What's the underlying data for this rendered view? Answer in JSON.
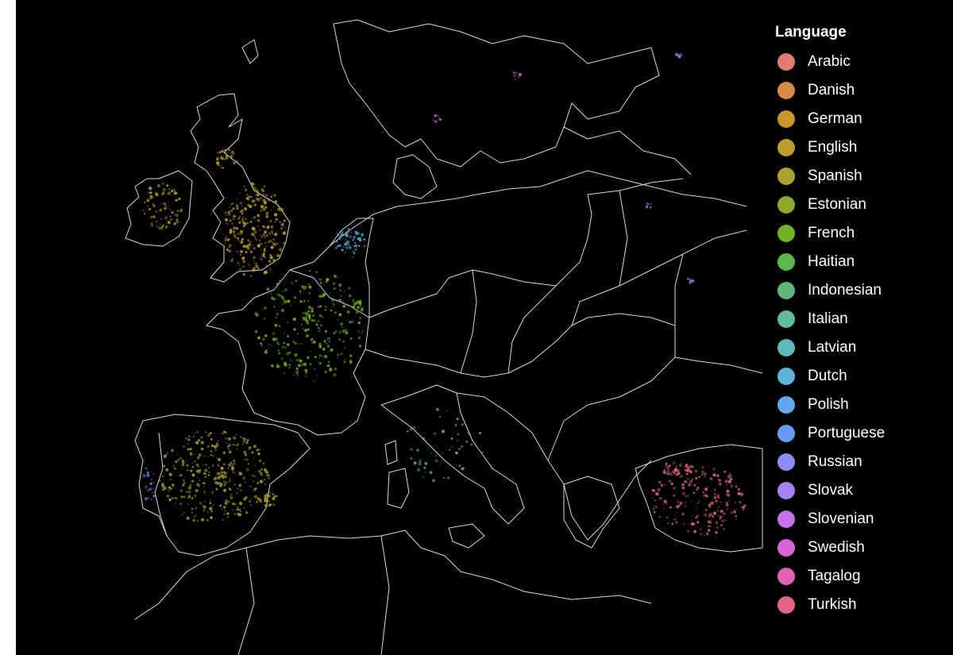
{
  "legend": {
    "title": "Language",
    "items": [
      {
        "label": "Arabic",
        "color": "#E07B70"
      },
      {
        "label": "Danish",
        "color": "#D98B45"
      },
      {
        "label": "German",
        "color": "#C9962B"
      },
      {
        "label": "English",
        "color": "#BC9E2C"
      },
      {
        "label": "Spanish",
        "color": "#A7A32D"
      },
      {
        "label": "Estonian",
        "color": "#8DAA2A"
      },
      {
        "label": "French",
        "color": "#70B324"
      },
      {
        "label": "Haitian",
        "color": "#5CB84B"
      },
      {
        "label": "Indonesian",
        "color": "#5DB87A"
      },
      {
        "label": "Italian",
        "color": "#5EBB9B"
      },
      {
        "label": "Latvian",
        "color": "#5BBBBB"
      },
      {
        "label": "Dutch",
        "color": "#5CB4D8"
      },
      {
        "label": "Polish",
        "color": "#5EA9F0"
      },
      {
        "label": "Portuguese",
        "color": "#6B9AF5"
      },
      {
        "label": "Russian",
        "color": "#8C8CF7"
      },
      {
        "label": "Slovak",
        "color": "#A880F5"
      },
      {
        "label": "Slovenian",
        "color": "#C471ED"
      },
      {
        "label": "Swedish",
        "color": "#D864D8"
      },
      {
        "label": "Tagalog",
        "color": "#E062B5"
      },
      {
        "label": "Turkish",
        "color": "#E36686"
      }
    ]
  },
  "map": {
    "background_color": "#000000",
    "border_color": "#D9D9D9",
    "clusters": [
      {
        "language": "English",
        "region": "Great Britain"
      },
      {
        "language": "English",
        "region": "Ireland"
      },
      {
        "language": "French",
        "region": "France"
      },
      {
        "language": "Spanish",
        "region": "Iberian Peninsula"
      },
      {
        "language": "Dutch",
        "region": "Netherlands"
      },
      {
        "language": "Portuguese",
        "region": "Portugal"
      },
      {
        "language": "Turkish",
        "region": "Turkey"
      },
      {
        "language": "Russian",
        "region": "Eastern Europe"
      },
      {
        "language": "Swedish",
        "region": "Scandinavia"
      },
      {
        "language": "Italian",
        "region": "Italy"
      }
    ]
  }
}
